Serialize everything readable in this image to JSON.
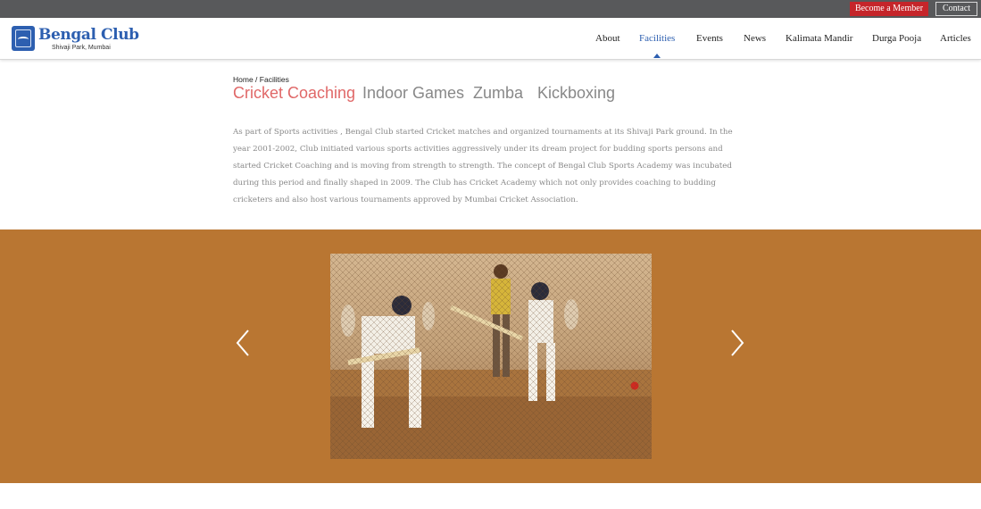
{
  "topbar": {
    "become_member": "Become a Member",
    "contact": "Contact"
  },
  "header": {
    "brand": "Bengal Club",
    "tagline": "Shivaji Park, Mumbai"
  },
  "nav": {
    "items": [
      "About",
      "Facilities",
      "Events",
      "News",
      "Kalimata Mandir",
      "Durga Pooja",
      "Articles"
    ],
    "active": "Facilities"
  },
  "breadcrumb": {
    "home": "Home",
    "separator": " / ",
    "current": "Facilities"
  },
  "tabs": {
    "items": [
      "Cricket Coaching",
      "Indoor Games",
      "Zumba",
      "Kickboxing"
    ],
    "active": "Cricket Coaching"
  },
  "content": {
    "paragraph": "As part of Sports activities , Bengal Club started Cricket matches and organized tournaments at its Shivaji Park ground. In the year 2001-2002, Club initiated various sports activities aggressively under its dream project for budding sports persons and started Cricket Coaching and is moving from strength to strength. The concept of Bengal Club Sports Academy was incubated during this period and finally shaped in 2009. The Club has Cricket Academy which not only provides coaching to budding cricketers and also host various tournaments approved by Mumbai Cricket Association."
  },
  "slider": {
    "prev_icon": "chevron-left-icon",
    "next_icon": "chevron-right-icon",
    "image": "cricket-nets-practice-photo"
  },
  "colors": {
    "topbar": "#58595b",
    "member_button": "#c5252a",
    "brand": "#2d5fb0",
    "active_tab": "#e06868",
    "slider_bg": "#b97632"
  }
}
